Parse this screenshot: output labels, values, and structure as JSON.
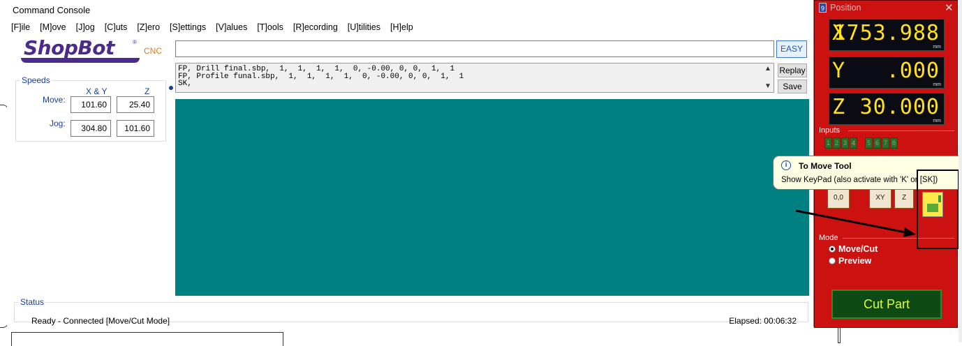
{
  "console": {
    "title": "Command Console",
    "menu": [
      "[F]ile",
      "[M]ove",
      "[J]og",
      "[C]uts",
      "[Z]ero",
      "[S]ettings",
      "[V]alues",
      "[T]ools",
      "[R]ecording",
      "[U]tilities",
      "[H]elp"
    ],
    "logo": {
      "name": "ShopBot",
      "suffix": "CNC",
      "reg": "®"
    },
    "speeds": {
      "legend": "Speeds",
      "col_xy": "X & Y",
      "col_z": "Z",
      "move_label": "Move:",
      "jog_label": "Jog:",
      "move_xy": "101.60",
      "move_z": "25.40",
      "jog_xy": "304.80",
      "jog_z": "101.60"
    },
    "command_input": "",
    "easy_label": "EASY",
    "history": [
      "FP, Drill final.sbp,  1,  1,  1,  1,  0, -0.00, 0, 0,  1,  1",
      "FP, Profile funal.sbp,  1,  1,  1,  1,  0, -0.00, 0, 0,  1,  1",
      "SK,"
    ],
    "replay_label": "Replay",
    "save_label": "Save",
    "status": {
      "legend": "Status",
      "text": "Ready - Connected  [Move/Cut Mode]",
      "elapsed": "Elapsed: 00:06:32"
    },
    "preview_color": "#008080"
  },
  "position": {
    "title": "Position",
    "x": {
      "axis": "X",
      "value": "1753.988",
      "unit": "mm"
    },
    "y": {
      "axis": "Y",
      "value": ".000",
      "unit": "mm"
    },
    "z": {
      "axis": "Z",
      "value": "30.000",
      "unit": "mm"
    },
    "inputs_label": "Inputs",
    "inputs": [
      "1",
      "2",
      "3",
      "4",
      "5",
      "6",
      "7",
      "8"
    ],
    "tool_labels": {
      "zero": "0,0",
      "xy": "XY",
      "z": "Z"
    },
    "mode_label": "Mode",
    "modes": [
      "Move/Cut",
      "Preview"
    ],
    "cut_part_label": "Cut Part",
    "panel_color": "#cc1111"
  },
  "tooltip": {
    "title": "To Move Tool",
    "body": "Show KeyPad (also activate with 'K' or [SK])"
  }
}
